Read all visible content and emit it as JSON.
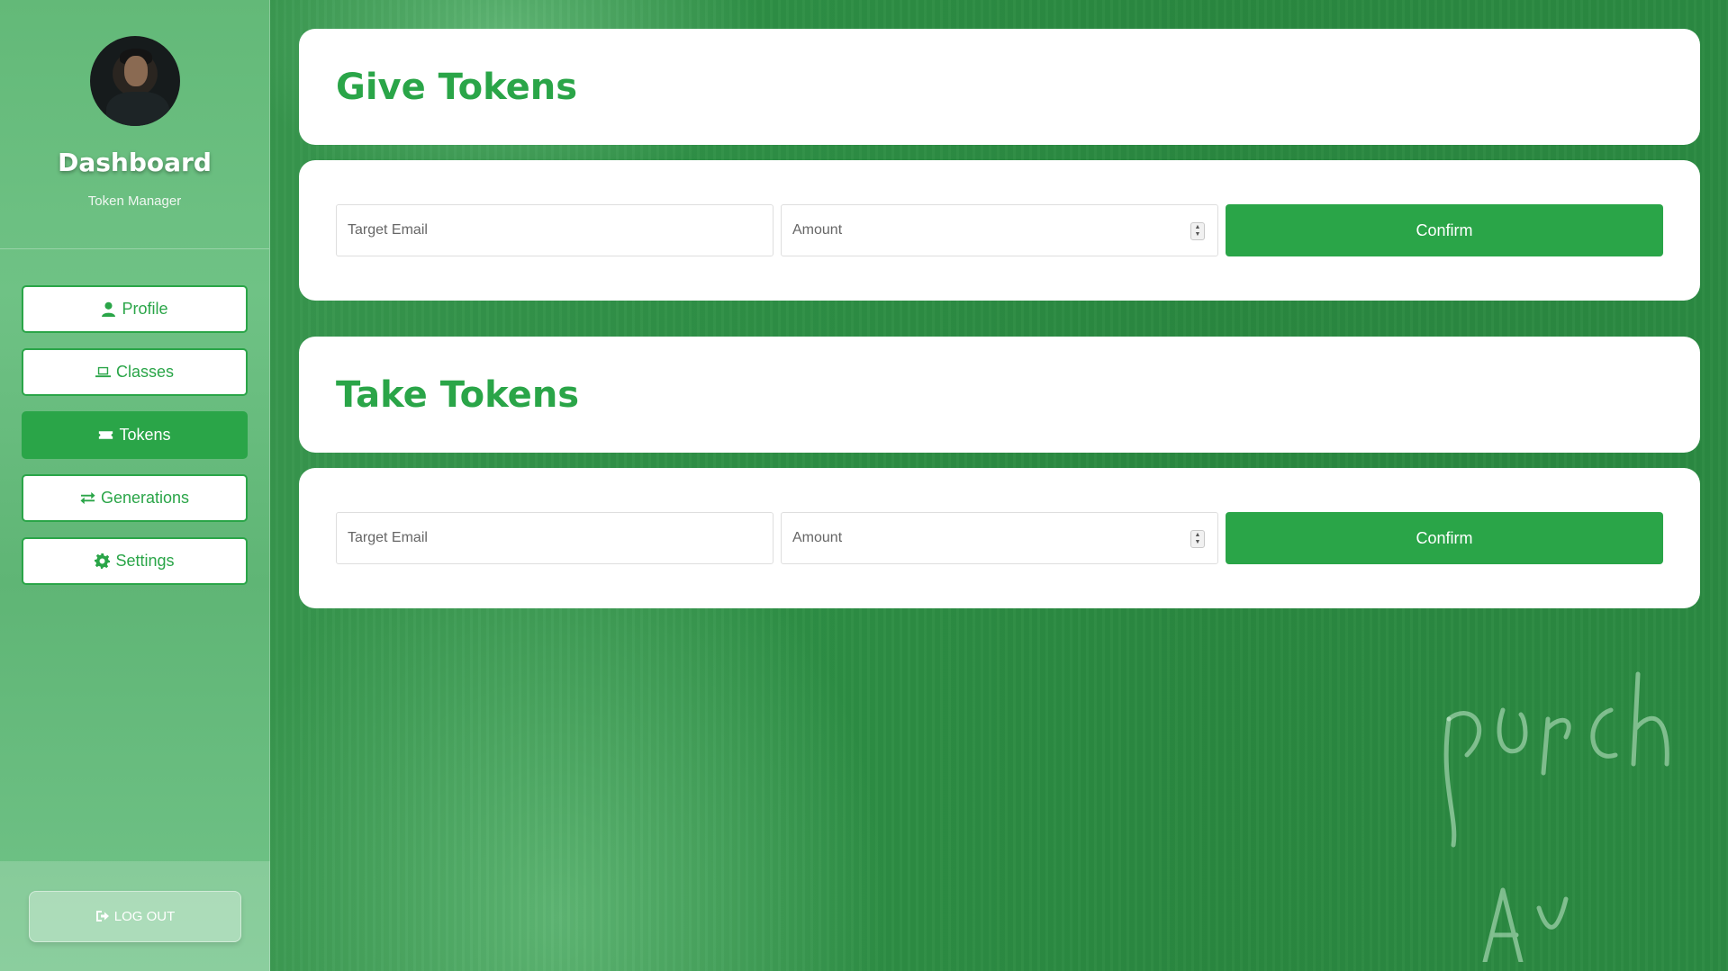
{
  "sidebar": {
    "title": "Dashboard",
    "subtitle": "Token Manager",
    "avatar_icon": "user-photo",
    "items": [
      {
        "label": "Profile",
        "icon": "user-icon",
        "active": false
      },
      {
        "label": "Classes",
        "icon": "laptop-icon",
        "active": false
      },
      {
        "label": "Tokens",
        "icon": "ticket-icon",
        "active": true
      },
      {
        "label": "Generations",
        "icon": "exchange-icon",
        "active": false
      },
      {
        "label": "Settings",
        "icon": "gear-icon",
        "active": false
      }
    ],
    "logout_label": "LOG OUT"
  },
  "give": {
    "title": "Give Tokens",
    "email_placeholder": "Target Email",
    "amount_placeholder": "Amount",
    "confirm_label": "Confirm"
  },
  "take": {
    "title": "Take Tokens",
    "email_placeholder": "Target Email",
    "amount_placeholder": "Amount",
    "confirm_label": "Confirm"
  },
  "colors": {
    "accent": "#2aa548",
    "background": "#2f8a44",
    "sidebar": "#6fc285"
  }
}
